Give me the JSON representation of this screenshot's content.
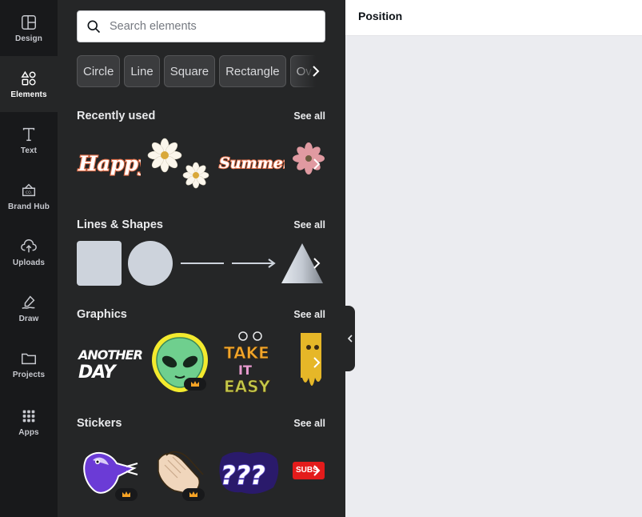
{
  "rail": {
    "items": [
      {
        "label": "Design",
        "icon": "design-icon"
      },
      {
        "label": "Elements",
        "icon": "elements-icon",
        "active": true
      },
      {
        "label": "Text",
        "icon": "text-icon"
      },
      {
        "label": "Brand Hub",
        "icon": "brand-hub-icon"
      },
      {
        "label": "Uploads",
        "icon": "uploads-icon"
      },
      {
        "label": "Draw",
        "icon": "draw-icon"
      },
      {
        "label": "Projects",
        "icon": "projects-icon"
      },
      {
        "label": "Apps",
        "icon": "apps-icon"
      }
    ]
  },
  "search": {
    "placeholder": "Search elements",
    "value": ""
  },
  "chips": [
    "Circle",
    "Line",
    "Square",
    "Rectangle",
    "Ov"
  ],
  "sections": {
    "recently_used": {
      "title": "Recently used",
      "see_all": "See all",
      "items": [
        {
          "name": "happy-sticker",
          "text": "Happy"
        },
        {
          "name": "daisies-graphic"
        },
        {
          "name": "summer-sticker",
          "text": "Summer"
        },
        {
          "name": "pink-flower-graphic"
        }
      ]
    },
    "lines_shapes": {
      "title": "Lines & Shapes",
      "see_all": "See all",
      "items": [
        "square",
        "circle",
        "line",
        "arrow-line",
        "triangle"
      ]
    },
    "graphics": {
      "title": "Graphics",
      "see_all": "See all",
      "items": [
        {
          "name": "another-day-graphic",
          "text_top": "ANOTHER",
          "text_bottom": "DAY"
        },
        {
          "name": "alien-graphic",
          "premium": true
        },
        {
          "name": "take-it-easy-graphic",
          "text_top": "TAKE",
          "text_mid": "IT",
          "text_bottom": "EASY"
        },
        {
          "name": "melting-smiley-graphic"
        }
      ]
    },
    "stickers": {
      "title": "Stickers",
      "see_all": "See all",
      "items": [
        {
          "name": "bird-sticker",
          "premium": true
        },
        {
          "name": "clapping-hands-sticker",
          "premium": true
        },
        {
          "name": "question-marks-sticker",
          "text": "???"
        },
        {
          "name": "subscribe-sticker",
          "text": "SUBS"
        }
      ]
    }
  },
  "topbar": {
    "position_label": "Position"
  },
  "colors": {
    "rail_bg": "#18191b",
    "panel_bg": "#252627",
    "canvas_bg": "#ebecf0",
    "premium_crown": "#f7a325"
  }
}
